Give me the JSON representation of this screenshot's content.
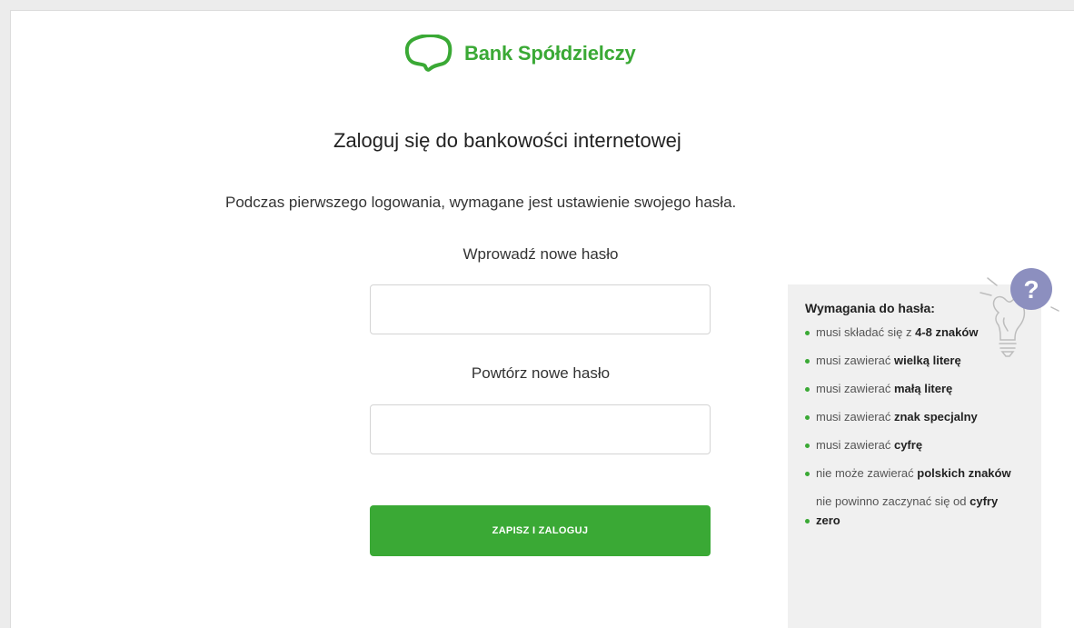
{
  "brand": {
    "name": "Bank Spółdzielczy",
    "color": "#3aa935"
  },
  "page": {
    "heading": "Zaloguj się do bankowości internetowej",
    "info": "Podczas pierwszego logowania, wymagane jest ustawienie swojego hasła."
  },
  "form": {
    "new_password_label": "Wprowadź nowe hasło",
    "new_password_value": "",
    "repeat_password_label": "Powtórz nowe hasło",
    "repeat_password_value": "",
    "submit_label": "ZAPISZ I ZALOGUJ"
  },
  "requirements": {
    "title": "Wymagania do hasła:",
    "icon": "lightbulb-question-icon",
    "items": [
      {
        "text": "musi składać się z ",
        "bold": "4-8 znaków"
      },
      {
        "text": "musi zawierać ",
        "bold": "wielką literę"
      },
      {
        "text": "musi zawierać ",
        "bold": "małą literę"
      },
      {
        "text": "musi zawierać ",
        "bold": "znak specjalny"
      },
      {
        "text": "musi zawierać ",
        "bold": "cyfrę"
      },
      {
        "text": "nie może zawierać ",
        "bold": "polskich znaków"
      },
      {
        "text": "nie powinno zaczynać się od ",
        "bold": "cyfry zero"
      }
    ]
  }
}
